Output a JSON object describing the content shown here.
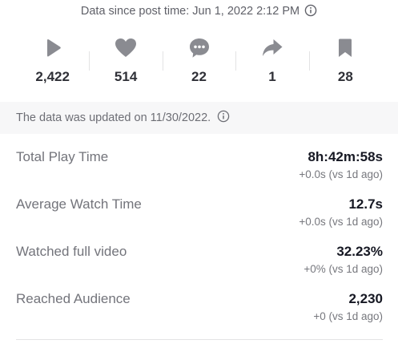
{
  "header": {
    "since_text": "Data since post time: Jun 1, 2022 2:12 PM",
    "info_icon": "info-circle-icon"
  },
  "stats": [
    {
      "icon": "play-icon",
      "value": "2,422"
    },
    {
      "icon": "heart-icon",
      "value": "514"
    },
    {
      "icon": "comment-icon",
      "value": "22"
    },
    {
      "icon": "share-icon",
      "value": "1"
    },
    {
      "icon": "bookmark-icon",
      "value": "28"
    }
  ],
  "banner": {
    "text": "The data was updated on 11/30/2022.",
    "info_icon": "info-circle-icon"
  },
  "metrics": [
    {
      "label": "Total Play Time",
      "value": "8h:42m:58s",
      "delta": "+0.0s (vs 1d ago)"
    },
    {
      "label": "Average Watch Time",
      "value": "12.7s",
      "delta": "+0.0s (vs 1d ago)"
    },
    {
      "label": "Watched full video",
      "value": "32.23%",
      "delta": "+0% (vs 1d ago)"
    },
    {
      "label": "Reached Audience",
      "value": "2,230",
      "delta": "+0 (vs 1d ago)"
    }
  ],
  "colors": {
    "icon_gray": "#8a8b91",
    "text_primary": "#161823",
    "text_secondary": "#73747b",
    "banner_bg": "#f7f7f8"
  }
}
